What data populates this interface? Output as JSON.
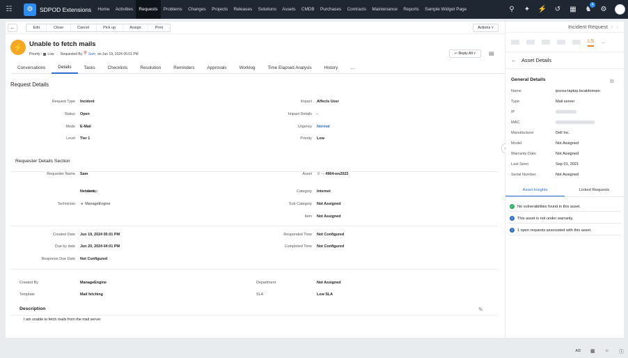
{
  "app": {
    "name": "SDPOD Extensions"
  },
  "nav": {
    "items": [
      "Home",
      "Activities",
      "Requests",
      "Problems",
      "Changes",
      "Projects",
      "Releases",
      "Solutions",
      "Assets",
      "CMDB",
      "Purchases",
      "Contracts",
      "Maintenance",
      "Reports",
      "Sample Widget Page"
    ],
    "active": "Requests",
    "notif_count": "4"
  },
  "toolbar": {
    "buttons": [
      "Edit",
      "Close",
      "Cancel",
      "Pick up",
      "Assign",
      "Print"
    ],
    "actions": "Actions"
  },
  "request": {
    "title": "Unable to fetch mails",
    "priority_label": "Priority :",
    "priority": "Low",
    "requested_by_label": "Requested By",
    "requester": "Sam",
    "on_date": "on Jun 19, 2024 05:01 PM",
    "reply_all": "Reply All"
  },
  "tabs": [
    "Conversations",
    "Details",
    "Tasks",
    "Checklists",
    "Resolution",
    "Reminders",
    "Approvals",
    "Worklog",
    "Time Elapsed Analysis",
    "History",
    "..."
  ],
  "active_tab": "Details",
  "details": {
    "section_title": "Request Details",
    "fields_left": [
      {
        "label": "Request Type",
        "value": "Incident"
      },
      {
        "label": "Status",
        "value": "Open"
      },
      {
        "label": "Mode",
        "value": "E-Mail"
      },
      {
        "label": "Level",
        "value": "Tier 1"
      }
    ],
    "fields_right": [
      {
        "label": "Impact",
        "value": "Affects User"
      },
      {
        "label": "Impact Details",
        "value": "-"
      },
      {
        "label": "Urgency",
        "value": "Normal"
      },
      {
        "label": "Priority",
        "value": "Low"
      }
    ]
  },
  "requester_section": {
    "title": "Requester Details Section",
    "requester_name_label": "Requester Name",
    "requester_name": "Sam",
    "asset_label": "Asset",
    "asset": "4964-ws2022",
    "group_label": "Group",
    "group": "Network",
    "category_label": "Category",
    "category": "Internet",
    "technician_label": "Technician",
    "technician": "ManageEngine",
    "subcategory_label": "Sub Category",
    "subcategory": "Not Assigned",
    "item_label": "Item",
    "item": "Not Assigned"
  },
  "dates": {
    "created_label": "Created Date",
    "created": "Jun 19, 2024 05:01 PM",
    "responded_label": "Responded Time",
    "responded": "Not Configured",
    "due_label": "Due by date",
    "due": "Jun 20, 2024 04:01 PM",
    "completed_label": "Completed Time",
    "completed": "Not Configured",
    "response_due_label": "Response Due Date",
    "response_due": "Not Configured"
  },
  "misc": {
    "created_by_label": "Created By",
    "created_by": "ManageEngine",
    "department_label": "Department",
    "department": "Not Assigned",
    "template_label": "Template",
    "template": "Mail fetching",
    "sla_label": "SLA",
    "sla": "Low SLA"
  },
  "description": {
    "title": "Description",
    "text": "I am unable to fetch mails from the mail server"
  },
  "right_panel": {
    "header": "Incident Request",
    "ls_tab": "LS",
    "more": "...",
    "sub_title": "Asset Details",
    "general_title": "General Details",
    "fields": [
      {
        "k": "Name",
        "v": "ipcrea-laptop.localdomain"
      },
      {
        "k": "Type",
        "v": "Mail server"
      },
      {
        "k": "IP",
        "v": ""
      },
      {
        "k": "MAC",
        "v": ""
      },
      {
        "k": "Manufacturer",
        "v": "Dell Inc."
      },
      {
        "k": "Model",
        "v": "Not Assigned"
      },
      {
        "k": "Warranty Date",
        "v": "Not Assigned"
      },
      {
        "k": "Last Seen",
        "v": "Sep 01, 2021"
      },
      {
        "k": "Serial Number",
        "v": "Not Assigned"
      }
    ],
    "insight_tabs": [
      "Asset Insights",
      "Linked Requests"
    ],
    "insights": [
      {
        "text": "No vulnerabilities found in this asset.",
        "color": "#27ae60",
        "icon": "check"
      },
      {
        "text": "This asset is not under warranty.",
        "color": "#2d6ecf",
        "icon": "info"
      },
      {
        "text": "1 open requests associated with this asset.",
        "color": "#2d6ecf",
        "icon": "info"
      }
    ]
  }
}
